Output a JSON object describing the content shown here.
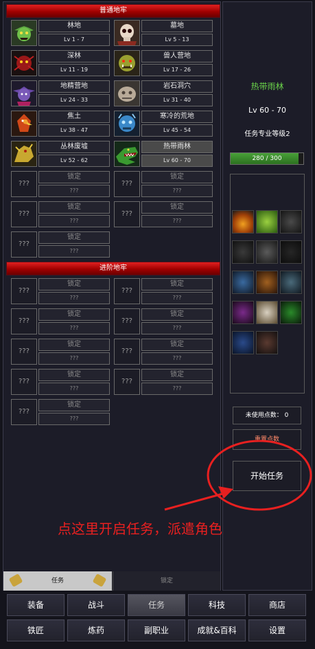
{
  "sections": {
    "normal": "普通地牢",
    "advanced": "进阶地牢"
  },
  "dungeons_normal": [
    {
      "name": "林地",
      "level": "Lv 1 - 7",
      "icon": "goblin-icon"
    },
    {
      "name": "墓地",
      "level": "Lv 5 - 13",
      "icon": "skull-icon"
    },
    {
      "name": "深林",
      "level": "Lv 11 - 19",
      "icon": "red-spider-icon"
    },
    {
      "name": "兽人营地",
      "level": "Lv 17 - 26",
      "icon": "orc-icon"
    },
    {
      "name": "地精营地",
      "level": "Lv 24 - 33",
      "icon": "purple-goblin-icon"
    },
    {
      "name": "岩石洞穴",
      "level": "Lv 31 - 40",
      "icon": "rock-golem-icon"
    },
    {
      "name": "焦土",
      "level": "Lv 38 - 47",
      "icon": "phoenix-icon"
    },
    {
      "name": "寒冷的荒地",
      "level": "Lv 45 - 54",
      "icon": "ice-troll-icon"
    },
    {
      "name": "丛林废墟",
      "level": "Lv 52 - 62",
      "icon": "yellow-dragon-icon"
    },
    {
      "name": "热带雨林",
      "level": "Lv 60 - 70",
      "icon": "crocodile-icon"
    }
  ],
  "locked": {
    "icon_text": "???",
    "name": "锁定",
    "level": "???"
  },
  "right_panel": {
    "selected_name": "热带雨林",
    "selected_level": "Lv 60 - 70",
    "mastery": "任务专业等级2",
    "exp_text": "280 / 300",
    "exp_progress": 0.933,
    "unused_points": "未使用点数： 0",
    "reset_points": "重置点数",
    "start_task": "开始任务"
  },
  "tabs": {
    "task": "任务",
    "locked": "锁定"
  },
  "nav": {
    "row1": [
      "装备",
      "战斗",
      "任务",
      "科技",
      "商店"
    ],
    "row2": [
      "铁匠",
      "炼药",
      "副职业",
      "成就&百科",
      "设置"
    ]
  },
  "annotation": "点这里开启任务，派遣角色",
  "colors": {
    "header_red": "#c01010",
    "accent_green": "#6ad24a",
    "annotation_red": "#e82020",
    "exp_green": "#48a038"
  }
}
